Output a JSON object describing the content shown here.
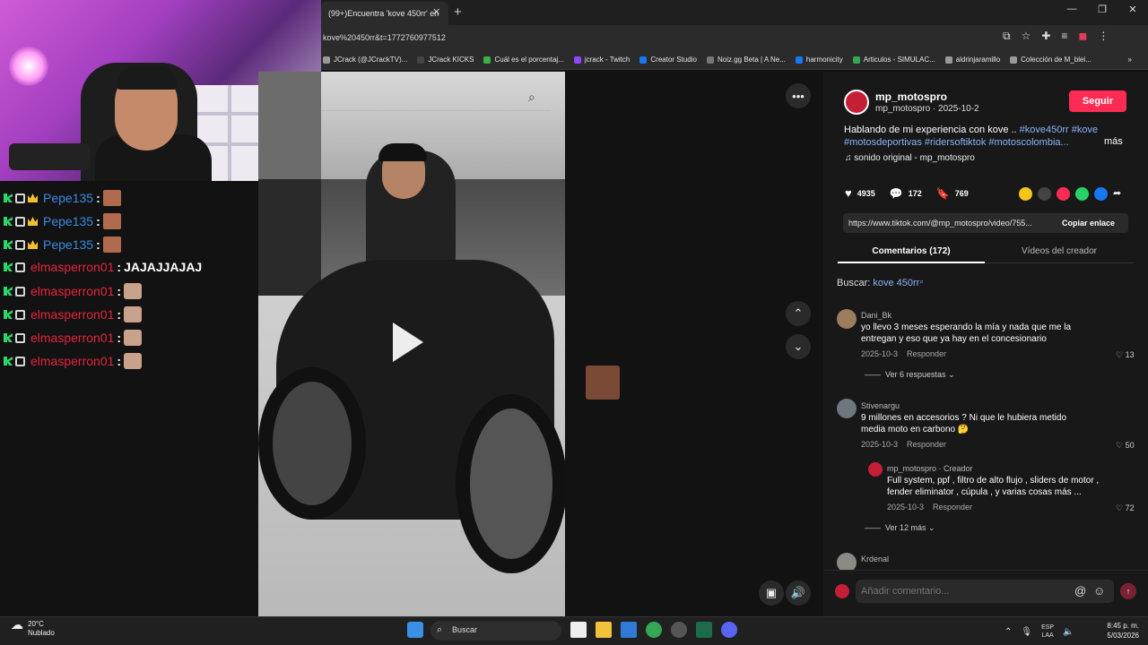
{
  "browser": {
    "tab_title": "(99+)Encuentra 'kove 450rr' en",
    "tab_close": "✕",
    "new_tab": "+",
    "url": "kove%20450rr&t=1772760977512",
    "window_controls": [
      "—",
      "❐",
      "✕"
    ],
    "bookmarks": [
      {
        "label": "JCrack (@JCrackTV)...",
        "color": "#9a9a9a"
      },
      {
        "label": "JCrack KICKS",
        "color": "#444444"
      },
      {
        "label": "Cuál es el porcentaj...",
        "color": "#3cb043"
      },
      {
        "label": "jcrack - Twitch",
        "color": "#9146ff"
      },
      {
        "label": "Creator Studio",
        "color": "#1877f2"
      },
      {
        "label": "Noiz.gg Beta | A Ne...",
        "color": "#777777"
      },
      {
        "label": "harmonicity",
        "color": "#1877f2"
      },
      {
        "label": "Articulos - SIMULAC...",
        "color": "#34a853"
      },
      {
        "label": "aldrinjaramillo",
        "color": "#9a9a9a"
      },
      {
        "label": "Colección de M_blei...",
        "color": "#9a9a9a"
      }
    ],
    "bookmarks_overflow": "»"
  },
  "chat": {
    "messages": [
      {
        "user": "Pepe135",
        "color": "#3b8be0",
        "text": "",
        "emote": "a",
        "badges": 3
      },
      {
        "user": "Pepe135",
        "color": "#3b8be0",
        "text": "",
        "emote": "a",
        "badges": 3
      },
      {
        "user": "Pepe135",
        "color": "#3b8be0",
        "text": "",
        "emote": "a",
        "badges": 3
      },
      {
        "user": "elmasperron01",
        "color": "#e5243b",
        "text": "JAJAJJAJAJ",
        "emote": "",
        "badges": 2
      },
      {
        "user": "elmasperron01",
        "color": "#e5243b",
        "text": "",
        "emote": "b",
        "badges": 2
      },
      {
        "user": "elmasperron01",
        "color": "#e5243b",
        "text": "",
        "emote": "b",
        "badges": 2
      },
      {
        "user": "elmasperron01",
        "color": "#e5243b",
        "text": "",
        "emote": "b",
        "badges": 2
      },
      {
        "user": "elmasperron01",
        "color": "#e5243b",
        "text": "",
        "emote": "b",
        "badges": 2
      }
    ]
  },
  "post": {
    "author": "mp_motospro",
    "author_sub": "mp_motospro · 2025-10-2",
    "follow_label": "Seguir",
    "description_text": "Hablando de mi experiencia con kove .. ",
    "description_tags": "#kove450rr #kove #motosdeportivas #ridersoftiktok #motoscolombia...",
    "more_label": "más",
    "sound": "♫  sonido original - mp_motospro",
    "likes": "4935",
    "comments_count": "172",
    "saves": "769",
    "link": "https://www.tiktok.com/@mp_motospro/video/755...",
    "copy_link_label": "Copiar enlace",
    "tab_comments": "Comentarios (172)",
    "tab_videos": "Vídeos del creador",
    "search_prefix": "Buscar: ",
    "search_term": "kove 450rr"
  },
  "comments": [
    {
      "name": "Dani_Bk",
      "text": "yo llevo 3 meses esperando la mía y nada que me la entregan y eso que ya hay en el concesionario",
      "date": "2025-10-3",
      "reply": "Responder",
      "likes": "13",
      "replies": "Ver 6 respuestas ⌄"
    },
    {
      "name": "Stivenargu",
      "text": "9 millones en accesorios ? Ni que le hubiera metido media moto en carbono 🤔",
      "date": "2025-10-3",
      "reply": "Responder",
      "likes": "50",
      "replies": ""
    },
    {
      "name": "mp_motospro · Creador",
      "text": "Full system, ppf , filtro de alto flujo , sliders de motor , fender eliminator , cúpula , y varias cosas más ...",
      "date": "2025-10-3",
      "reply": "Responder",
      "likes": "72",
      "replies": "Ver 12 más ⌄"
    },
    {
      "name": "Krdenal",
      "text": "",
      "date": "",
      "reply": "",
      "likes": "",
      "replies": ""
    }
  ],
  "add_comment": {
    "placeholder": "Añadir comentario...",
    "at": "@",
    "emoji": "☺",
    "send": "↑"
  },
  "taskbar": {
    "temp": "20°C",
    "weather": "Nublado",
    "search": "Buscar",
    "lang1": "ESP",
    "lang2": "LAA",
    "time": "8:45 p. m.",
    "date": "5/03/2026"
  }
}
